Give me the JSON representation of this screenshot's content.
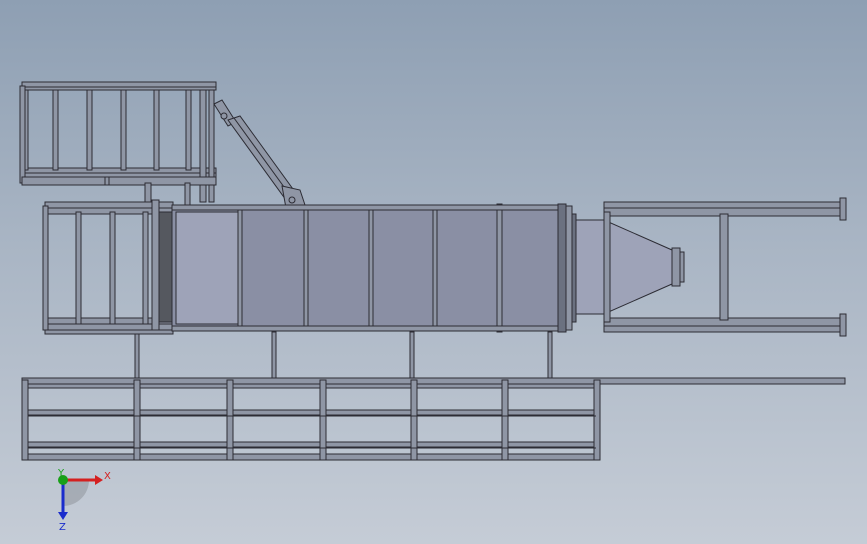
{
  "axis_triad": {
    "x_label": "X",
    "y_label": "Y",
    "z_label": "Z",
    "colors": {
      "x": "#d42020",
      "y": "#18a018",
      "z": "#1a2ccc"
    }
  },
  "palette": {
    "background_top": "#8e9fb3",
    "background_bottom": "#c5ccd6",
    "edge": "#2c2c34",
    "steel": "#8f96a5",
    "duct": "#8a8fa4"
  }
}
